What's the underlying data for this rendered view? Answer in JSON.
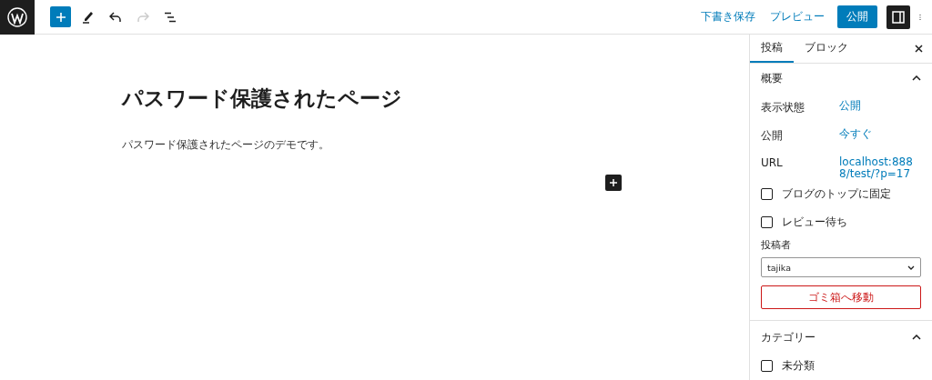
{
  "toolbar": {
    "tools": [
      {
        "kind": "inserter",
        "disabled": false
      },
      {
        "kind": "pen",
        "disabled": false
      },
      {
        "kind": "undo",
        "disabled": false
      },
      {
        "kind": "redo",
        "disabled": true
      },
      {
        "kind": "outline",
        "disabled": false
      }
    ],
    "actions": {
      "save_draft": "下書き保存",
      "preview": "プレビュー",
      "publish": "公開",
      "settings_pressed": true
    }
  },
  "editor": {
    "title": "パスワード保護されたページ",
    "paragraph": "パスワード保護されたページのデモです。"
  },
  "sidebar": {
    "tabs": [
      {
        "label": "投稿",
        "selected": true
      },
      {
        "label": "ブロック",
        "selected": false
      }
    ],
    "summary": {
      "title": "概要",
      "expanded": true,
      "rows": [
        {
          "label": "表示状態",
          "value": "公開"
        },
        {
          "label": "公開",
          "value": "今すぐ"
        },
        {
          "label": "URL",
          "value": "localhost:8888/test/?p=17"
        }
      ],
      "checkboxes": [
        {
          "label": "ブログのトップに固定",
          "checked": false
        },
        {
          "label": "レビュー待ち",
          "checked": false
        }
      ],
      "author_label": "投稿者",
      "author": "tajika",
      "trash": "ゴミ箱へ移動"
    },
    "categories": {
      "title": "カテゴリー",
      "expanded": true,
      "items": [
        {
          "label": "未分類",
          "checked": false
        }
      ]
    }
  }
}
